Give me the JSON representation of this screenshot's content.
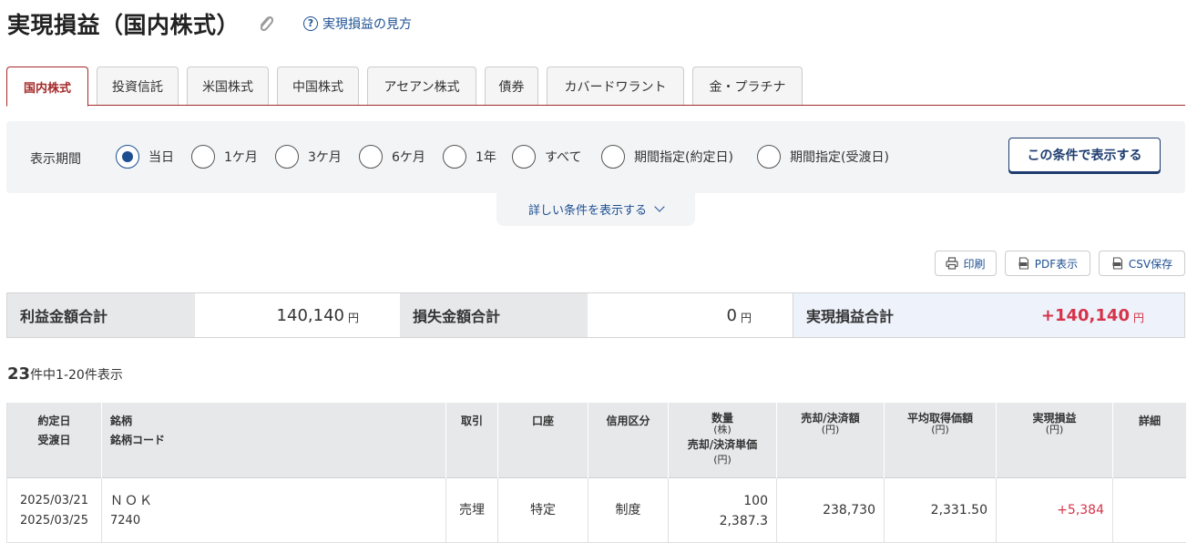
{
  "header": {
    "title": "実現損益（国内株式）",
    "help_link": "実現損益の見方"
  },
  "tabs": [
    {
      "label": "国内株式",
      "active": true
    },
    {
      "label": "投資信託",
      "active": false
    },
    {
      "label": "米国株式",
      "active": false
    },
    {
      "label": "中国株式",
      "active": false
    },
    {
      "label": "アセアン株式",
      "active": false
    },
    {
      "label": "債券",
      "active": false
    },
    {
      "label": "カバードワラント",
      "active": false
    },
    {
      "label": "金・プラチナ",
      "active": false
    }
  ],
  "filter": {
    "label": "表示期間",
    "options": [
      {
        "label": "当日",
        "checked": true
      },
      {
        "label": "1ケ月",
        "checked": false
      },
      {
        "label": "3ケ月",
        "checked": false
      },
      {
        "label": "6ケ月",
        "checked": false
      },
      {
        "label": "1年",
        "checked": false
      },
      {
        "label": "すべて",
        "checked": false
      },
      {
        "label": "期間指定(約定日)",
        "checked": false
      },
      {
        "label": "期間指定(受渡日)",
        "checked": false
      }
    ],
    "submit_label": "この条件で表示する",
    "more_label": "詳しい条件を表示する"
  },
  "actions": {
    "print": "印刷",
    "pdf": "PDF表示",
    "csv": "CSV保存"
  },
  "summary": {
    "profit_label": "利益金額合計",
    "profit_value": "140,140",
    "loss_label": "損失金額合計",
    "loss_value": "0",
    "total_label": "実現損益合計",
    "total_value": "+140,140",
    "unit": "円"
  },
  "count": {
    "total": "23",
    "text": "件中1-20件表示"
  },
  "table": {
    "headers": {
      "date1": "約定日",
      "date2": "受渡日",
      "name1": "銘柄",
      "name2": "銘柄コード",
      "trade": "取引",
      "account": "口座",
      "credit": "信用区分",
      "qty": "数量",
      "qty_unit": "(株)",
      "price": "売却/決済単価",
      "price_unit": "(円)",
      "amount": "売却/決済額",
      "amount_unit": "(円)",
      "avg": "平均取得価額",
      "avg_unit": "(円)",
      "pl": "実現損益",
      "pl_unit": "(円)",
      "detail": "詳細"
    },
    "rows": [
      {
        "trade_date": "2025/03/21",
        "settle_date": "2025/03/25",
        "name": "ＮＯＫ",
        "code": "7240",
        "trade": "売埋",
        "account": "特定",
        "credit": "制度",
        "qty": "100",
        "price": "2,387.3",
        "amount": "238,730",
        "avg": "2,331.50",
        "pl": "+5,384"
      }
    ]
  },
  "colors": {
    "accent_red": "#a52a2a",
    "link_blue": "#1d4f91",
    "profit_red": "#d6334a"
  }
}
